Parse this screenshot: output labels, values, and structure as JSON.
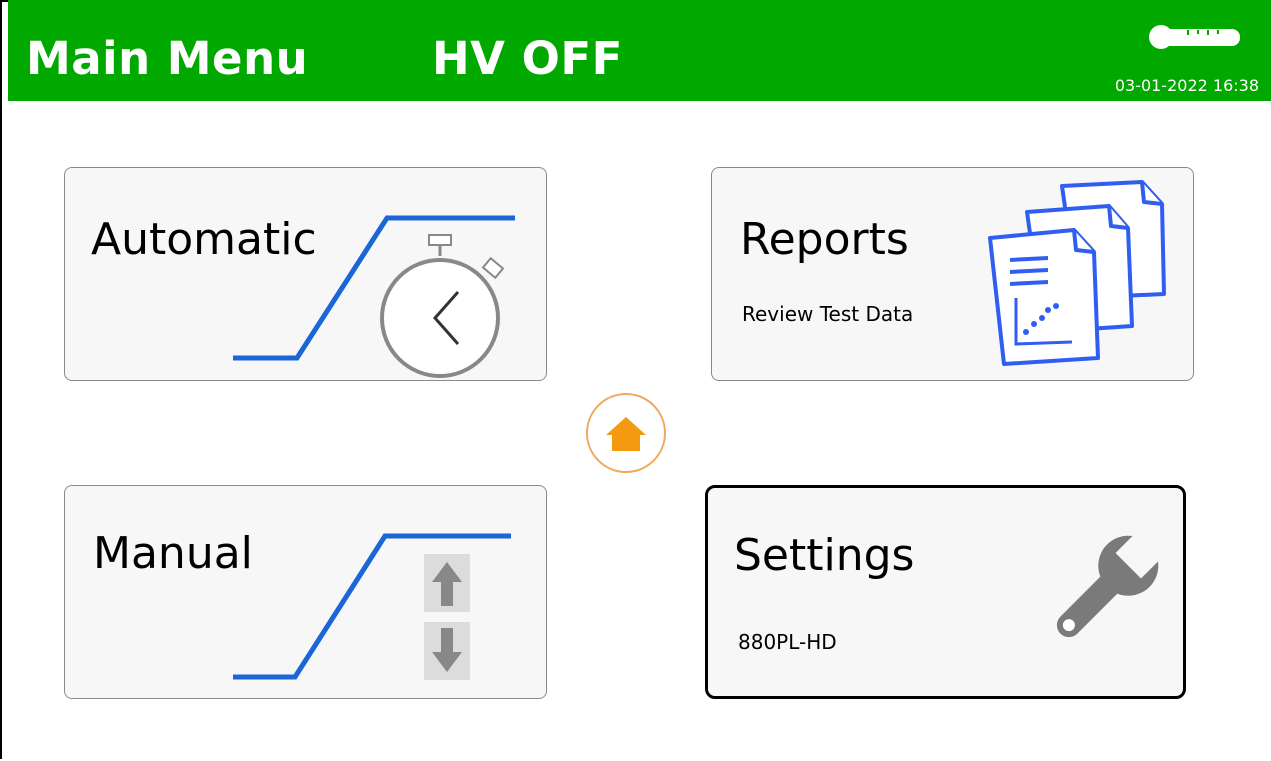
{
  "header": {
    "title": "Main Menu",
    "hv_status": "HV OFF",
    "datetime": "03-01-2022 16:38",
    "thermometer_icon": "thermometer-icon",
    "color": "#00a800"
  },
  "menu": {
    "automatic": {
      "label": "Automatic",
      "icon": "stopwatch-icon"
    },
    "reports": {
      "label": "Reports",
      "subtitle": "Review Test Data",
      "icon": "documents-icon"
    },
    "manual": {
      "label": "Manual",
      "icon": "up-down-arrows-icon"
    },
    "settings": {
      "label": "Settings",
      "subtitle": "880PL-HD",
      "icon": "wrench-icon"
    }
  },
  "home_button": {
    "icon": "home-icon",
    "color": "#f39a10"
  },
  "accent_color": "#1a66d6"
}
